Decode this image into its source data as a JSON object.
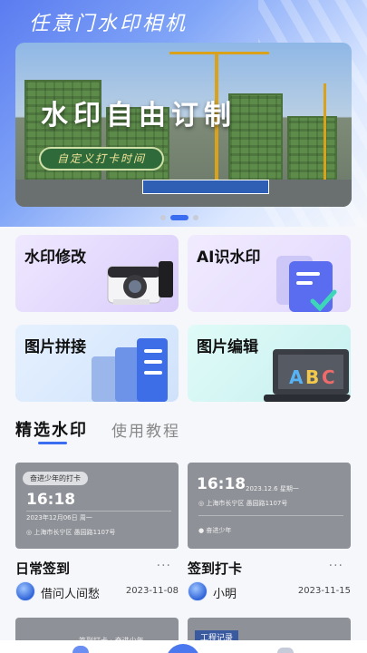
{
  "app": {
    "title": "任意门水印相机"
  },
  "banner": {
    "title": "水印自由订制",
    "pill": "自定义打卡时间",
    "page_dots": {
      "count": 3,
      "active_index": 1
    }
  },
  "features": [
    {
      "label": "水印修改",
      "icon": "camera-icon"
    },
    {
      "label": "AI识水印",
      "icon": "document-check-icon"
    },
    {
      "label": "图片拼接",
      "icon": "stacked-pages-icon"
    },
    {
      "label": "图片编辑",
      "icon": "laptop-abc-icon"
    }
  ],
  "tabs": [
    {
      "label": "精选水印",
      "active": true
    },
    {
      "label": "使用教程",
      "active": false
    }
  ],
  "cards": [
    {
      "name": "日常签到",
      "more": "···",
      "user": "借问人间愁",
      "date": "2023-11-08",
      "watermark": {
        "tag": "奋进少年的打卡",
        "time": "16:18",
        "date_line": "2023年12月06日 周一",
        "address": "上海市长宁区 愚园路1107号"
      }
    },
    {
      "name": "签到打卡",
      "more": "···",
      "user": "小明",
      "date": "2023-11-15",
      "watermark": {
        "time": "16:18",
        "date_line": "2023.12.6 星期一",
        "address": "上海市长宁区 愚园路1107号",
        "user": "奋进少年"
      }
    }
  ],
  "partial_cards": [
    {
      "caption": "签到打卡 · 奋进少年"
    },
    {
      "caption": "工程记录"
    }
  ],
  "colors": {
    "accent": "#3b6df0"
  }
}
